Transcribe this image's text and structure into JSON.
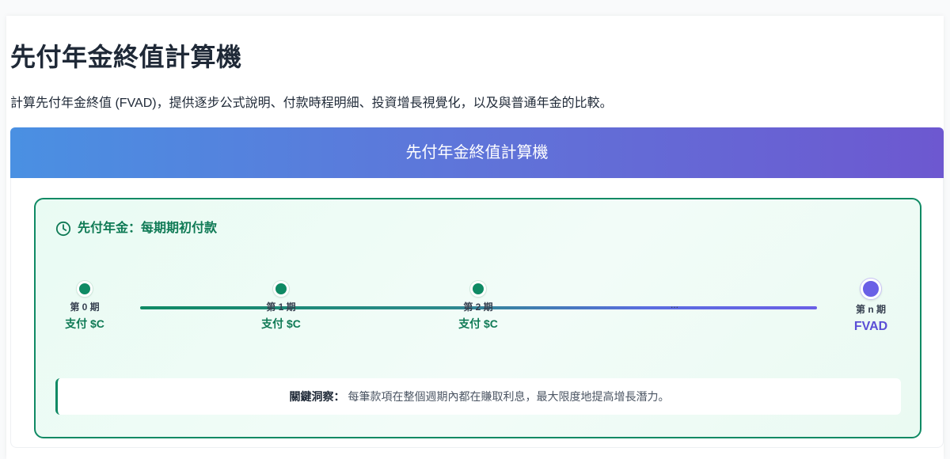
{
  "page": {
    "title": "先付年金終值計算機",
    "description": "計算先付年金終值 (FVAD)，提供逐步公式說明、付款時程明細、投資增長視覺化，以及與普通年金的比較。"
  },
  "calculator": {
    "header_title": "先付年金終值計算機"
  },
  "annuity_card": {
    "heading": "先付年金：每期期初付款",
    "icon": "clock-icon",
    "timeline": [
      {
        "label": "第 0 期",
        "value": "支付 $C"
      },
      {
        "label": "第 1 期",
        "value": "支付 $C"
      },
      {
        "label": "第 2 期",
        "value": "支付 $C"
      },
      {
        "label": "...",
        "value": ""
      },
      {
        "label": "第 n 期",
        "value": "FVAD"
      }
    ],
    "insight_label": "關鍵洞察：",
    "insight_text": "每筆款項在整個週期內都在賺取利息，最大限度地提高增長潛力。"
  },
  "colors": {
    "accent_green": "#0f8a64",
    "accent_purple": "#6a5fe6",
    "header_gradient_start": "#4a90e2",
    "header_gradient_end": "#6d58d0"
  }
}
